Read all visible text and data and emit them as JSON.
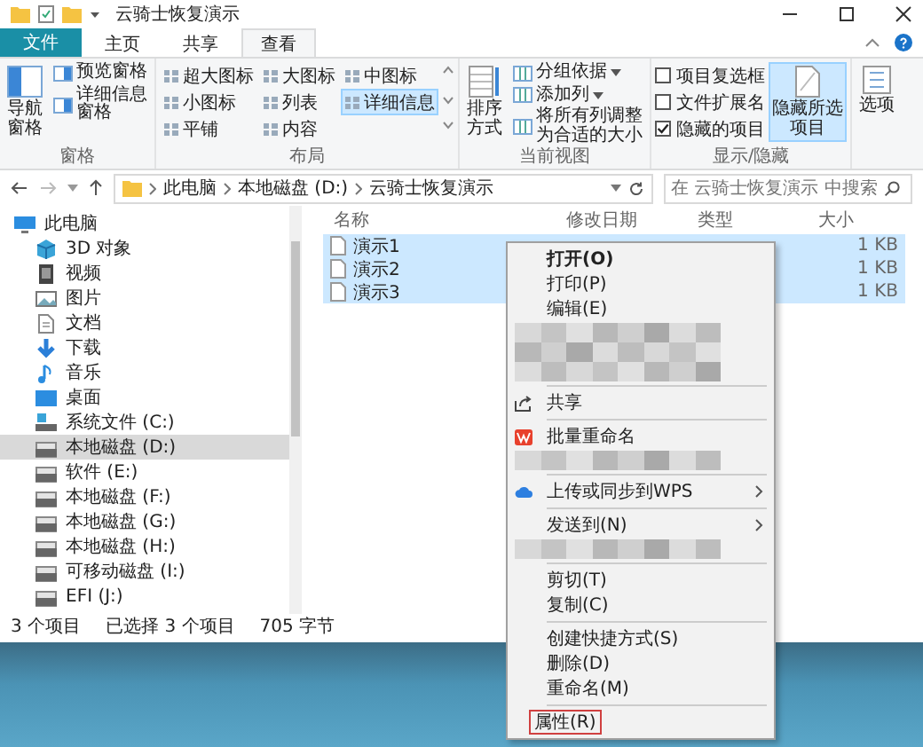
{
  "window": {
    "title": "云骑士恢复演示"
  },
  "tabs": [
    {
      "label": "文件",
      "kind": "file",
      "selected": false
    },
    {
      "label": "主页",
      "kind": "tab",
      "selected": false
    },
    {
      "label": "共享",
      "kind": "tab",
      "selected": false
    },
    {
      "label": "查看",
      "kind": "tab",
      "selected": true
    }
  ],
  "ribbon": {
    "panes": {
      "label": "窗格",
      "big": "导航窗格",
      "items": [
        "预览窗格",
        "详细信息窗格"
      ]
    },
    "layout": {
      "label": "布局",
      "items": [
        {
          "label": "超大图标",
          "selected": false
        },
        {
          "label": "大图标",
          "selected": false
        },
        {
          "label": "中图标",
          "selected": false
        },
        {
          "label": "小图标",
          "selected": false
        },
        {
          "label": "列表",
          "selected": false
        },
        {
          "label": "详细信息",
          "selected": true
        },
        {
          "label": "平铺",
          "selected": false
        },
        {
          "label": "内容",
          "selected": false
        }
      ]
    },
    "current_view": {
      "label": "当前视图",
      "big": "排序方式",
      "items": [
        {
          "label": "分组依据",
          "dropdown": true
        },
        {
          "label": "添加列",
          "dropdown": true
        },
        {
          "label": "将所有列调整为合适的大小",
          "dropdown": false
        }
      ]
    },
    "show_hide": {
      "label": "显示/隐藏",
      "checkboxes": [
        {
          "label": "项目复选框",
          "checked": false
        },
        {
          "label": "文件扩展名",
          "checked": false
        },
        {
          "label": "隐藏的项目",
          "checked": true
        }
      ],
      "hide_button": {
        "label": "隐藏所选项目",
        "on": true
      }
    },
    "options": {
      "label": "选项"
    }
  },
  "address": {
    "breadcrumbs": [
      "此电脑",
      "本地磁盘 (D:)",
      "云骑士恢复演示"
    ],
    "search_placeholder": "在 云骑士恢复演示 中搜索"
  },
  "sidebar": {
    "items": [
      {
        "label": "此电脑",
        "kind": "pc",
        "selected": false,
        "children": [
          {
            "label": "3D 对象",
            "kind": "cube",
            "selected": false
          },
          {
            "label": "视频",
            "kind": "video",
            "selected": false
          },
          {
            "label": "图片",
            "kind": "picture",
            "selected": false
          },
          {
            "label": "文档",
            "kind": "document",
            "selected": false
          },
          {
            "label": "下载",
            "kind": "download",
            "selected": false
          },
          {
            "label": "音乐",
            "kind": "music",
            "selected": false
          },
          {
            "label": "桌面",
            "kind": "desktop",
            "selected": false
          },
          {
            "label": "系统文件 (C:)",
            "kind": "system-drive",
            "selected": false
          },
          {
            "label": "本地磁盘 (D:)",
            "kind": "drive",
            "selected": true
          },
          {
            "label": "软件 (E:)",
            "kind": "drive",
            "selected": false
          },
          {
            "label": "本地磁盘 (F:)",
            "kind": "drive",
            "selected": false
          },
          {
            "label": "本地磁盘 (G:)",
            "kind": "drive",
            "selected": false
          },
          {
            "label": "本地磁盘 (H:)",
            "kind": "drive",
            "selected": false
          },
          {
            "label": "可移动磁盘 (I:)",
            "kind": "drive",
            "selected": false
          },
          {
            "label": "EFI (J:)",
            "kind": "drive",
            "selected": false
          }
        ]
      }
    ]
  },
  "files": {
    "columns": [
      "名称",
      "修改日期",
      "类型",
      "大小"
    ],
    "rows": [
      {
        "name": "演示1",
        "size": "1 KB",
        "selected": true
      },
      {
        "name": "演示2",
        "size": "1 KB",
        "selected": true
      },
      {
        "name": "演示3",
        "size": "1 KB",
        "selected": true
      }
    ]
  },
  "status_bar": {
    "count": "3 个项目",
    "selection": "已选择 3 个项目",
    "size": "705 字节"
  },
  "context_menu": {
    "items": [
      {
        "kind": "command",
        "label": "打开(O)",
        "default": true,
        "highlighted": false
      },
      {
        "kind": "command",
        "label": "打印(P)",
        "default": false,
        "highlighted": false
      },
      {
        "kind": "command",
        "label": "编辑(E)",
        "default": false,
        "highlighted": false
      },
      {
        "kind": "blurred-tall"
      },
      {
        "kind": "separator"
      },
      {
        "kind": "share",
        "label": "共享",
        "default": false,
        "highlighted": false
      },
      {
        "kind": "separator"
      },
      {
        "kind": "wps",
        "label": "批量重命名",
        "default": false,
        "highlighted": false
      },
      {
        "kind": "blurred"
      },
      {
        "kind": "separator"
      },
      {
        "kind": "cloud",
        "label": "上传或同步到WPS",
        "submenu": true,
        "default": false,
        "highlighted": false
      },
      {
        "kind": "separator"
      },
      {
        "kind": "command",
        "label": "发送到(N)",
        "submenu": true,
        "default": false,
        "highlighted": false
      },
      {
        "kind": "blurred"
      },
      {
        "kind": "separator"
      },
      {
        "kind": "command",
        "label": "剪切(T)",
        "default": false,
        "highlighted": false
      },
      {
        "kind": "command",
        "label": "复制(C)",
        "default": false,
        "highlighted": false
      },
      {
        "kind": "separator"
      },
      {
        "kind": "command",
        "label": "创建快捷方式(S)",
        "default": false,
        "highlighted": false
      },
      {
        "kind": "command",
        "label": "删除(D)",
        "default": false,
        "highlighted": false
      },
      {
        "kind": "command",
        "label": "重命名(M)",
        "default": false,
        "highlighted": false
      },
      {
        "kind": "separator"
      },
      {
        "kind": "command",
        "label": "属性(R)",
        "default": false,
        "highlighted": true
      }
    ]
  }
}
